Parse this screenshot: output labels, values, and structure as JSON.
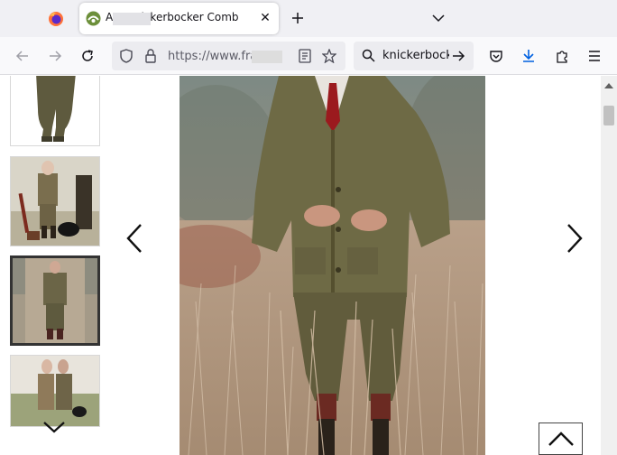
{
  "browser": {
    "tab": {
      "title": "A… Knickerbocker Comb",
      "favicon": "site-favicon-icon",
      "close": "✕"
    },
    "firefox_tab_icon": "firefox-icon",
    "new_tab_icon": "plus-icon",
    "list_tabs_icon": "chevron-down-icon",
    "nav": {
      "back_icon": "back-arrow-icon",
      "forward_icon": "forward-arrow-icon",
      "reload_icon": "reload-icon",
      "url": "https://www.fra",
      "search_query": "knickerbock",
      "pocket_icon": "pocket-icon",
      "downloads_icon": "download-icon",
      "extensions_icon": "puzzle-icon",
      "menu_icon": "hamburger-menu-icon"
    },
    "accent": "#0061e0"
  },
  "gallery": {
    "thumbnails": [
      {
        "name": "thumbnail-trousers",
        "active": false
      },
      {
        "name": "thumbnail-man-with-dog",
        "active": false
      },
      {
        "name": "thumbnail-man-in-field",
        "active": true
      },
      {
        "name": "thumbnail-couple",
        "active": false
      }
    ],
    "prev_arrow": "chevron-left-icon",
    "next_arrow": "chevron-right-icon",
    "thumbs_down_arrow": "chevron-down-icon",
    "back_to_top": "chevron-up-icon"
  }
}
